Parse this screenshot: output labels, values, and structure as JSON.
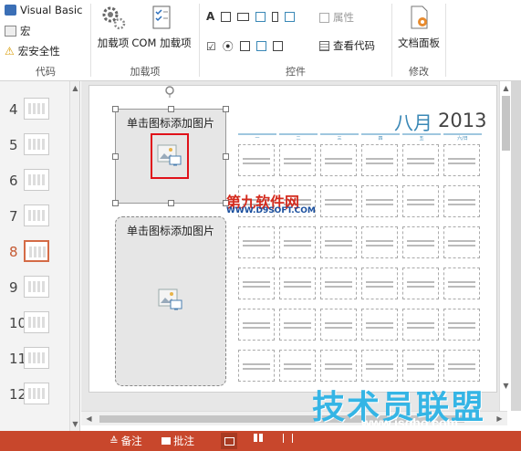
{
  "ribbon": {
    "code_group": {
      "visual_basic": "Visual Basic",
      "macros": "宏",
      "macro_security": "宏安全性",
      "label": "代码"
    },
    "addins_group": {
      "addins": "加载项",
      "com_addins": "COM 加载项",
      "label": "加载项"
    },
    "controls_group": {
      "properties": "属性",
      "view_code": "查看代码",
      "label": "控件"
    },
    "modify_group": {
      "document_panel": "文档面板",
      "label": "修改"
    }
  },
  "slides": {
    "numbers": [
      "4",
      "5",
      "6",
      "7",
      "8",
      "9",
      "10",
      "11",
      "12"
    ],
    "active": "8"
  },
  "slide": {
    "placeholder1_label": "单击图标添加图片",
    "placeholder2_label": "单击图标添加图片",
    "month": "八月",
    "year": "2013",
    "weekdays": [
      "一",
      "二",
      "三",
      "四",
      "五",
      "六/日"
    ]
  },
  "overlay_logo": {
    "text": "第九软件网",
    "url": "WWW.D9SOFT.COM"
  },
  "status": {
    "notes": "备注",
    "comments": "批注"
  },
  "watermark": {
    "text": "技术员联盟",
    "url": "www.jsgho.com"
  },
  "colors": {
    "accent": "#c8472c",
    "month_blue": "#3a88b6",
    "highlight_red": "#e0121a"
  }
}
